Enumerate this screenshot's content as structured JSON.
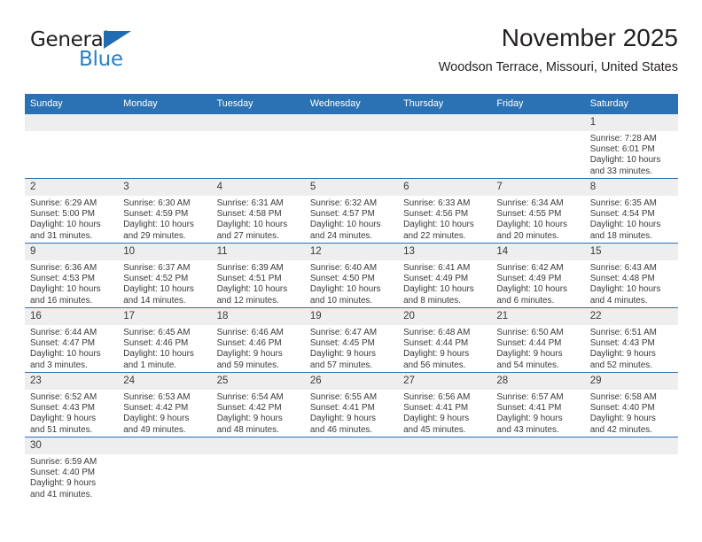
{
  "brand": {
    "name_top": "General",
    "name_bottom": "Blue",
    "flag_icon": "blue-triangle-flag-icon",
    "accent_color": "#2980c4",
    "dark_color": "#231f20"
  },
  "header": {
    "title": "November 2025",
    "subtitle": "Woodson Terrace, Missouri, United States"
  },
  "theme": {
    "header_bg": "#2b72b4",
    "header_text": "#ffffff",
    "daynum_bg": "#eeeeee",
    "row_divider": "#2b72b4",
    "body_text": "#3a3a3a"
  },
  "calendar": {
    "weekday_headers": [
      "Sunday",
      "Monday",
      "Tuesday",
      "Wednesday",
      "Thursday",
      "Friday",
      "Saturday"
    ],
    "weeks": [
      [
        {
          "day": "",
          "sunrise": "",
          "sunset": "",
          "daylight_1": "",
          "daylight_2": "",
          "empty": true
        },
        {
          "day": "",
          "sunrise": "",
          "sunset": "",
          "daylight_1": "",
          "daylight_2": "",
          "empty": true
        },
        {
          "day": "",
          "sunrise": "",
          "sunset": "",
          "daylight_1": "",
          "daylight_2": "",
          "empty": true
        },
        {
          "day": "",
          "sunrise": "",
          "sunset": "",
          "daylight_1": "",
          "daylight_2": "",
          "empty": true
        },
        {
          "day": "",
          "sunrise": "",
          "sunset": "",
          "daylight_1": "",
          "daylight_2": "",
          "empty": true
        },
        {
          "day": "",
          "sunrise": "",
          "sunset": "",
          "daylight_1": "",
          "daylight_2": "",
          "empty": true
        },
        {
          "day": "1",
          "sunrise": "Sunrise: 7:28 AM",
          "sunset": "Sunset: 6:01 PM",
          "daylight_1": "Daylight: 10 hours",
          "daylight_2": "and 33 minutes.",
          "empty": false
        }
      ],
      [
        {
          "day": "2",
          "sunrise": "Sunrise: 6:29 AM",
          "sunset": "Sunset: 5:00 PM",
          "daylight_1": "Daylight: 10 hours",
          "daylight_2": "and 31 minutes.",
          "empty": false
        },
        {
          "day": "3",
          "sunrise": "Sunrise: 6:30 AM",
          "sunset": "Sunset: 4:59 PM",
          "daylight_1": "Daylight: 10 hours",
          "daylight_2": "and 29 minutes.",
          "empty": false
        },
        {
          "day": "4",
          "sunrise": "Sunrise: 6:31 AM",
          "sunset": "Sunset: 4:58 PM",
          "daylight_1": "Daylight: 10 hours",
          "daylight_2": "and 27 minutes.",
          "empty": false
        },
        {
          "day": "5",
          "sunrise": "Sunrise: 6:32 AM",
          "sunset": "Sunset: 4:57 PM",
          "daylight_1": "Daylight: 10 hours",
          "daylight_2": "and 24 minutes.",
          "empty": false
        },
        {
          "day": "6",
          "sunrise": "Sunrise: 6:33 AM",
          "sunset": "Sunset: 4:56 PM",
          "daylight_1": "Daylight: 10 hours",
          "daylight_2": "and 22 minutes.",
          "empty": false
        },
        {
          "day": "7",
          "sunrise": "Sunrise: 6:34 AM",
          "sunset": "Sunset: 4:55 PM",
          "daylight_1": "Daylight: 10 hours",
          "daylight_2": "and 20 minutes.",
          "empty": false
        },
        {
          "day": "8",
          "sunrise": "Sunrise: 6:35 AM",
          "sunset": "Sunset: 4:54 PM",
          "daylight_1": "Daylight: 10 hours",
          "daylight_2": "and 18 minutes.",
          "empty": false
        }
      ],
      [
        {
          "day": "9",
          "sunrise": "Sunrise: 6:36 AM",
          "sunset": "Sunset: 4:53 PM",
          "daylight_1": "Daylight: 10 hours",
          "daylight_2": "and 16 minutes.",
          "empty": false
        },
        {
          "day": "10",
          "sunrise": "Sunrise: 6:37 AM",
          "sunset": "Sunset: 4:52 PM",
          "daylight_1": "Daylight: 10 hours",
          "daylight_2": "and 14 minutes.",
          "empty": false
        },
        {
          "day": "11",
          "sunrise": "Sunrise: 6:39 AM",
          "sunset": "Sunset: 4:51 PM",
          "daylight_1": "Daylight: 10 hours",
          "daylight_2": "and 12 minutes.",
          "empty": false
        },
        {
          "day": "12",
          "sunrise": "Sunrise: 6:40 AM",
          "sunset": "Sunset: 4:50 PM",
          "daylight_1": "Daylight: 10 hours",
          "daylight_2": "and 10 minutes.",
          "empty": false
        },
        {
          "day": "13",
          "sunrise": "Sunrise: 6:41 AM",
          "sunset": "Sunset: 4:49 PM",
          "daylight_1": "Daylight: 10 hours",
          "daylight_2": "and 8 minutes.",
          "empty": false
        },
        {
          "day": "14",
          "sunrise": "Sunrise: 6:42 AM",
          "sunset": "Sunset: 4:49 PM",
          "daylight_1": "Daylight: 10 hours",
          "daylight_2": "and 6 minutes.",
          "empty": false
        },
        {
          "day": "15",
          "sunrise": "Sunrise: 6:43 AM",
          "sunset": "Sunset: 4:48 PM",
          "daylight_1": "Daylight: 10 hours",
          "daylight_2": "and 4 minutes.",
          "empty": false
        }
      ],
      [
        {
          "day": "16",
          "sunrise": "Sunrise: 6:44 AM",
          "sunset": "Sunset: 4:47 PM",
          "daylight_1": "Daylight: 10 hours",
          "daylight_2": "and 3 minutes.",
          "empty": false
        },
        {
          "day": "17",
          "sunrise": "Sunrise: 6:45 AM",
          "sunset": "Sunset: 4:46 PM",
          "daylight_1": "Daylight: 10 hours",
          "daylight_2": "and 1 minute.",
          "empty": false
        },
        {
          "day": "18",
          "sunrise": "Sunrise: 6:46 AM",
          "sunset": "Sunset: 4:46 PM",
          "daylight_1": "Daylight: 9 hours",
          "daylight_2": "and 59 minutes.",
          "empty": false
        },
        {
          "day": "19",
          "sunrise": "Sunrise: 6:47 AM",
          "sunset": "Sunset: 4:45 PM",
          "daylight_1": "Daylight: 9 hours",
          "daylight_2": "and 57 minutes.",
          "empty": false
        },
        {
          "day": "20",
          "sunrise": "Sunrise: 6:48 AM",
          "sunset": "Sunset: 4:44 PM",
          "daylight_1": "Daylight: 9 hours",
          "daylight_2": "and 56 minutes.",
          "empty": false
        },
        {
          "day": "21",
          "sunrise": "Sunrise: 6:50 AM",
          "sunset": "Sunset: 4:44 PM",
          "daylight_1": "Daylight: 9 hours",
          "daylight_2": "and 54 minutes.",
          "empty": false
        },
        {
          "day": "22",
          "sunrise": "Sunrise: 6:51 AM",
          "sunset": "Sunset: 4:43 PM",
          "daylight_1": "Daylight: 9 hours",
          "daylight_2": "and 52 minutes.",
          "empty": false
        }
      ],
      [
        {
          "day": "23",
          "sunrise": "Sunrise: 6:52 AM",
          "sunset": "Sunset: 4:43 PM",
          "daylight_1": "Daylight: 9 hours",
          "daylight_2": "and 51 minutes.",
          "empty": false
        },
        {
          "day": "24",
          "sunrise": "Sunrise: 6:53 AM",
          "sunset": "Sunset: 4:42 PM",
          "daylight_1": "Daylight: 9 hours",
          "daylight_2": "and 49 minutes.",
          "empty": false
        },
        {
          "day": "25",
          "sunrise": "Sunrise: 6:54 AM",
          "sunset": "Sunset: 4:42 PM",
          "daylight_1": "Daylight: 9 hours",
          "daylight_2": "and 48 minutes.",
          "empty": false
        },
        {
          "day": "26",
          "sunrise": "Sunrise: 6:55 AM",
          "sunset": "Sunset: 4:41 PM",
          "daylight_1": "Daylight: 9 hours",
          "daylight_2": "and 46 minutes.",
          "empty": false
        },
        {
          "day": "27",
          "sunrise": "Sunrise: 6:56 AM",
          "sunset": "Sunset: 4:41 PM",
          "daylight_1": "Daylight: 9 hours",
          "daylight_2": "and 45 minutes.",
          "empty": false
        },
        {
          "day": "28",
          "sunrise": "Sunrise: 6:57 AM",
          "sunset": "Sunset: 4:41 PM",
          "daylight_1": "Daylight: 9 hours",
          "daylight_2": "and 43 minutes.",
          "empty": false
        },
        {
          "day": "29",
          "sunrise": "Sunrise: 6:58 AM",
          "sunset": "Sunset: 4:40 PM",
          "daylight_1": "Daylight: 9 hours",
          "daylight_2": "and 42 minutes.",
          "empty": false
        }
      ],
      [
        {
          "day": "30",
          "sunrise": "Sunrise: 6:59 AM",
          "sunset": "Sunset: 4:40 PM",
          "daylight_1": "Daylight: 9 hours",
          "daylight_2": "and 41 minutes.",
          "empty": false
        },
        {
          "day": "",
          "sunrise": "",
          "sunset": "",
          "daylight_1": "",
          "daylight_2": "",
          "empty": true
        },
        {
          "day": "",
          "sunrise": "",
          "sunset": "",
          "daylight_1": "",
          "daylight_2": "",
          "empty": true
        },
        {
          "day": "",
          "sunrise": "",
          "sunset": "",
          "daylight_1": "",
          "daylight_2": "",
          "empty": true
        },
        {
          "day": "",
          "sunrise": "",
          "sunset": "",
          "daylight_1": "",
          "daylight_2": "",
          "empty": true
        },
        {
          "day": "",
          "sunrise": "",
          "sunset": "",
          "daylight_1": "",
          "daylight_2": "",
          "empty": true
        },
        {
          "day": "",
          "sunrise": "",
          "sunset": "",
          "daylight_1": "",
          "daylight_2": "",
          "empty": true
        }
      ]
    ]
  }
}
